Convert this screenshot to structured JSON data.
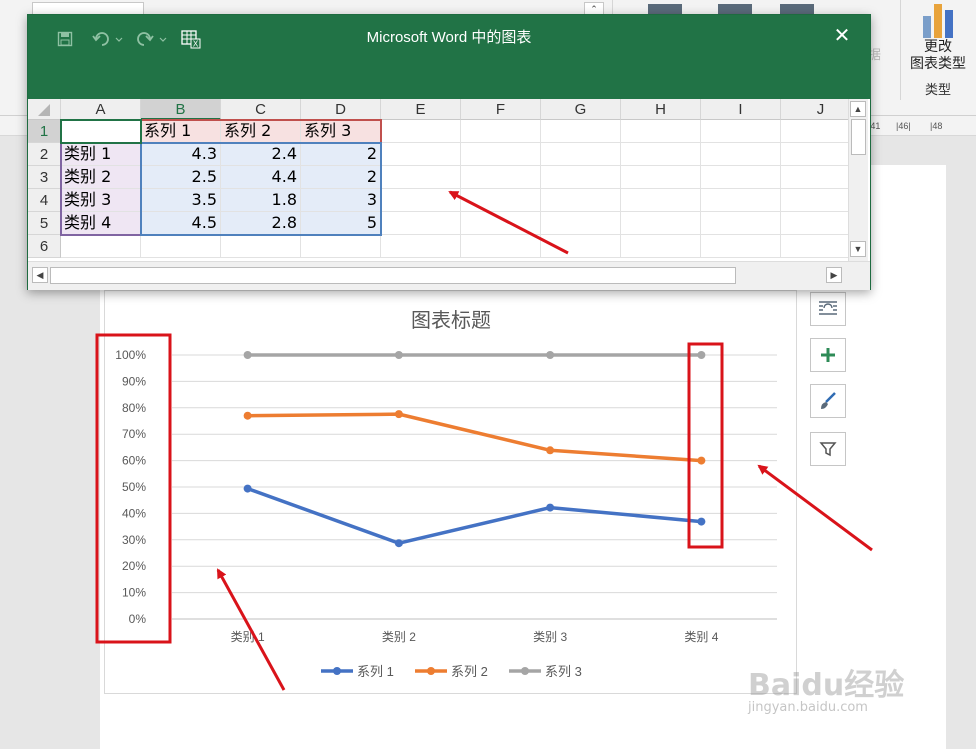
{
  "excel_window": {
    "title": "Microsoft Word 中的图表",
    "columns": [
      "A",
      "B",
      "C",
      "D",
      "E",
      "F",
      "G",
      "H",
      "I",
      "J"
    ],
    "rows": [
      "1",
      "2",
      "3",
      "4",
      "5",
      "6"
    ],
    "header_row": [
      "",
      "系列 1",
      "系列 2",
      "系列 3"
    ],
    "data_rows": [
      [
        "类别 1",
        "4.3",
        "2.4",
        "2"
      ],
      [
        "类别 2",
        "2.5",
        "4.4",
        "2"
      ],
      [
        "类别 3",
        "3.5",
        "1.8",
        "3"
      ],
      [
        "类别 4",
        "4.5",
        "2.8",
        "5"
      ]
    ],
    "close_label": "✕"
  },
  "ribbon": {
    "change_chart_type_label": "更改\n图表类型",
    "type_group_label": "类型",
    "data_label_ghost": "据"
  },
  "ruler": {
    "marks": [
      "|41",
      "|46|",
      "|48"
    ]
  },
  "chart_data": {
    "type": "line",
    "title": "图表标题",
    "categories": [
      "类别 1",
      "类别 2",
      "类别 3",
      "类别 4"
    ],
    "y_ticks": [
      "0%",
      "10%",
      "20%",
      "30%",
      "40%",
      "50%",
      "60%",
      "70%",
      "80%",
      "90%",
      "100%"
    ],
    "ylim": [
      0,
      1
    ],
    "series": [
      {
        "name": "系列 1",
        "values": [
          0.494,
          0.287,
          0.422,
          0.369
        ],
        "color": "#4472c4"
      },
      {
        "name": "系列 2",
        "values": [
          0.77,
          0.776,
          0.639,
          0.6
        ],
        "color": "#ed7d31"
      },
      {
        "name": "系列 3",
        "values": [
          1.0,
          1.0,
          1.0,
          1.0
        ],
        "color": "#a5a5a5"
      }
    ],
    "legend_position": "bottom",
    "grid": true
  },
  "chart_buttons": [
    "layout-options-icon",
    "chart-elements-plus-icon",
    "chart-styles-brush-icon",
    "chart-filters-icon"
  ],
  "watermark": {
    "main": "Baidu经验",
    "sub": "jingyan.baidu.com"
  },
  "colors": {
    "excel_green": "#217346",
    "annotation_red": "#d9131a"
  }
}
